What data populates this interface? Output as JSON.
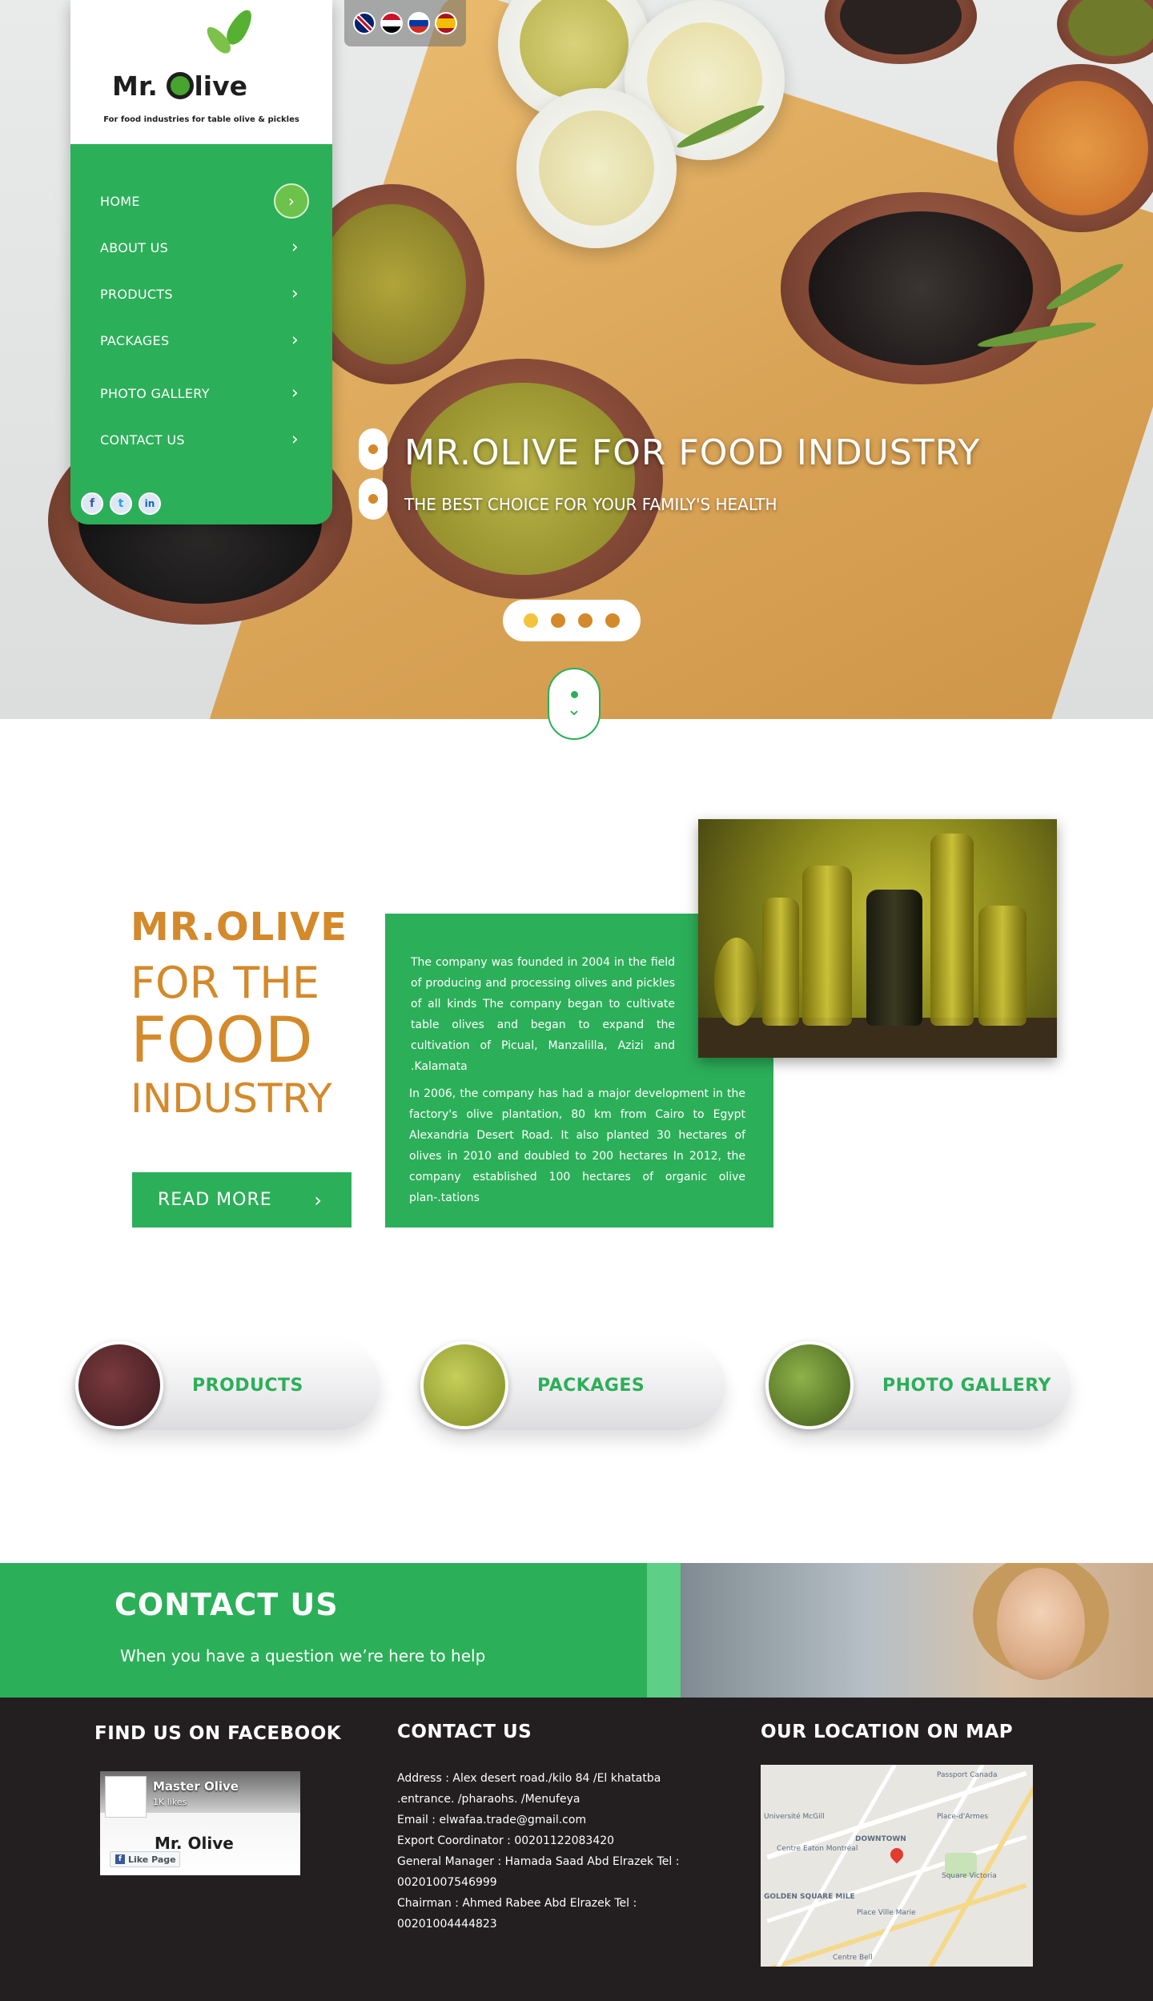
{
  "languages": [
    {
      "name": "english-flag-icon",
      "colors": [
        "#012169",
        "#ffffff",
        "#c8102e"
      ]
    },
    {
      "name": "egypt-flag-icon",
      "colors": [
        "#ce1126",
        "#ffffff",
        "#000000"
      ]
    },
    {
      "name": "russia-flag-icon",
      "colors": [
        "#ffffff",
        "#0039a6",
        "#d52b1e"
      ]
    },
    {
      "name": "spain-flag-icon",
      "colors": [
        "#aa151b",
        "#f1bf00",
        "#aa151b"
      ]
    }
  ],
  "logo": {
    "text_mr": "Mr.",
    "text_live": "live",
    "tagline": "For food industries for table olive & pickles"
  },
  "nav": {
    "items": [
      {
        "label": "HOME",
        "active": true
      },
      {
        "label": "ABOUT US",
        "active": false
      },
      {
        "label": "PRODUCTS",
        "active": false
      },
      {
        "label": "PACKAGES",
        "active": false
      },
      {
        "label": "PHOTO GALLERY",
        "active": false
      },
      {
        "label": "CONTACT US",
        "active": false
      }
    ],
    "chevron": "›"
  },
  "social": {
    "facebook": "f",
    "twitter": "t",
    "linkedin": "in"
  },
  "hero": {
    "title": "MR.OLIVE FOR FOOD INDUSTRY",
    "subtitle": "THE BEST CHOICE FOR YOUR FAMILY'S HEALTH",
    "slides": 4,
    "active_slide": 1
  },
  "about": {
    "heading_line1": "MR.OLIVE",
    "heading_line2": "FOR THE",
    "heading_line3": "FOOD",
    "heading_line4": "INDUSTRY",
    "read_more": "READ MORE",
    "paragraph1": "The company was founded in 2004 in the field of producing and processing olives and pickles of all kinds The company began to cultivate table olives and began to expand the cultivation of Picual, Manzalilla, Azizi and .Kalamata",
    "paragraph2": "In 2006, the company has had a major development in the factory's olive plantation, 80 km from Cairo to Egypt Alexandria Desert Road. It also planted 30 hectares of olives in 2010 and doubled to 200 hectares In 2012, the company established 100 hectares of organic olive plan-.tations"
  },
  "categories": [
    {
      "label": "PRODUCTS",
      "thumb_color": "#5a2a2e"
    },
    {
      "label": "PACKAGES",
      "thumb_color": "#9aa832"
    },
    {
      "label": "PHOTO GALLERY",
      "thumb_color": "#6b8f2a"
    }
  ],
  "contact_banner": {
    "title": "CONTACT US",
    "subtitle": "When you have a question we’re here to help"
  },
  "footer": {
    "facebook_heading": "FIND US ON FACEBOOK",
    "contact_heading": "CONTACT US",
    "map_heading": "OUR LOCATION ON MAP",
    "fb_page_name": "Master Olive",
    "fb_likes": "1K likes",
    "fb_like_button": "Like Page",
    "fb_logo_text": "Mr. Olive",
    "contact_lines": [
      "Address :  Alex desert road./kilo 84 /El khatatba",
      ".entrance. /pharaohs. /Menufeya",
      "Email : elwafaa.trade@gmail.com",
      "Export Coordinator : 00201122083420",
      "General Manager : Hamada Saad Abd Elrazek   Tel :",
      "00201007546999",
      "Chairman :  Ahmed Rabee Abd Elrazek  Tel :",
      "00201004444823"
    ],
    "map_labels": [
      "Université McGill",
      "DOWNTOWN",
      "Centre Eaton Montréal",
      "Place-d'Armes",
      "Square Victoria",
      "GOLDEN SQUARE MILE",
      "Centre Bell",
      "Place Ville Marie",
      "Passport Canada"
    ]
  },
  "colors": {
    "brand_green": "#2caf59",
    "accent_orange": "#d4892a",
    "footer_bg": "#231f20"
  }
}
